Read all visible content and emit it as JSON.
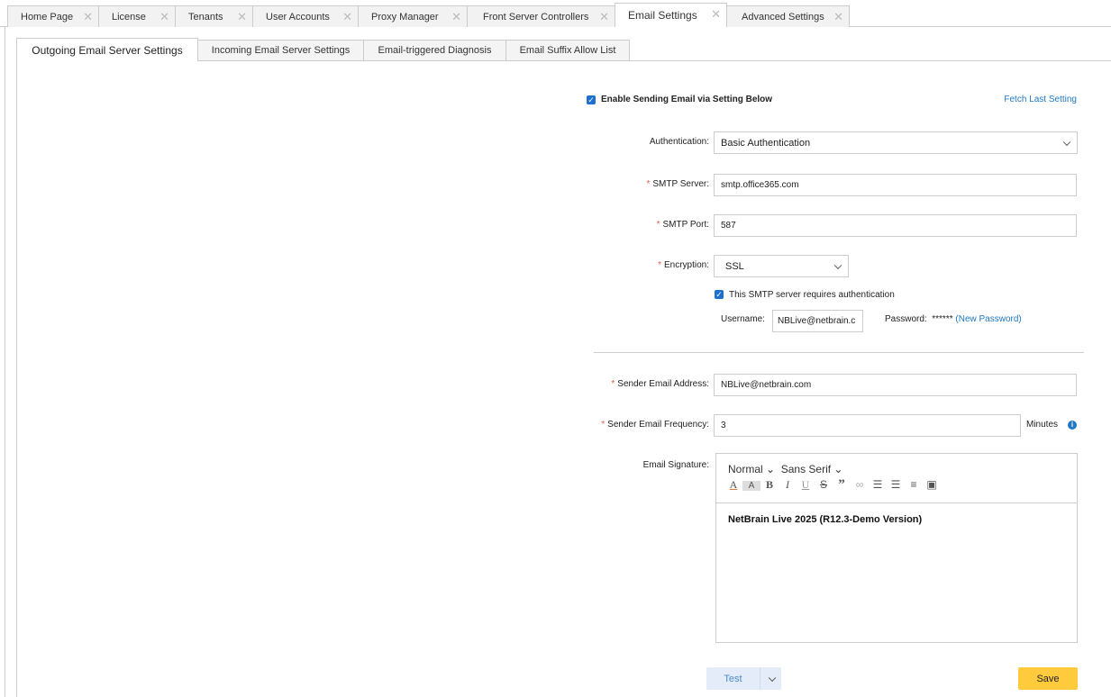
{
  "top_tabs": [
    {
      "label": "Home Page"
    },
    {
      "label": "License"
    },
    {
      "label": "Tenants"
    },
    {
      "label": "User Accounts"
    },
    {
      "label": "Proxy Manager"
    },
    {
      "label": "Front Server Controllers"
    },
    {
      "label": "Email Settings",
      "active": true
    },
    {
      "label": "Advanced Settings"
    }
  ],
  "close_glyph": "✕",
  "sub_tabs": [
    {
      "label": "Outgoing Email Server Settings",
      "active": true
    },
    {
      "label": "Incoming Email Server Settings"
    },
    {
      "label": "Email-triggered Diagnosis"
    },
    {
      "label": "Email Suffix Allow List"
    }
  ],
  "form": {
    "enable_label": "Enable Sending Email via Setting Below",
    "enable_checked": true,
    "fetch_last": "Fetch Last Setting",
    "required_mark": "*",
    "authentication_label": "Authentication:",
    "authentication_value": "Basic Authentication",
    "smtp_server_label": "SMTP Server:",
    "smtp_server_value": "smtp.office365.com",
    "smtp_port_label": "SMTP Port:",
    "smtp_port_value": "587",
    "encryption_label": "Encryption:",
    "encryption_value": "SSL",
    "requires_auth_label": "This SMTP server requires authentication",
    "requires_auth_checked": true,
    "username_label": "Username:",
    "username_value": "NBLive@netbrain.c",
    "password_label": "Password:",
    "password_mask": "******",
    "new_password": "(New Password)",
    "sender_address_label": "Sender Email Address:",
    "sender_address_value": "NBLive@netbrain.com",
    "frequency_label": "Sender Email Frequency:",
    "frequency_value": "3",
    "frequency_unit": "Minutes",
    "signature_label": "Email Signature:",
    "editor": {
      "size": "Normal",
      "font": "Sans Serif",
      "content": "NetBrain Live 2025 (R12.3-Demo Version)"
    }
  },
  "buttons": {
    "test": "Test",
    "save": "Save"
  },
  "colors": {
    "accent": "#1f6fd0",
    "save": "#ffcb3d",
    "test_bg": "#e3ecf8",
    "link": "#1f78c1",
    "required": "#e05a4a"
  }
}
